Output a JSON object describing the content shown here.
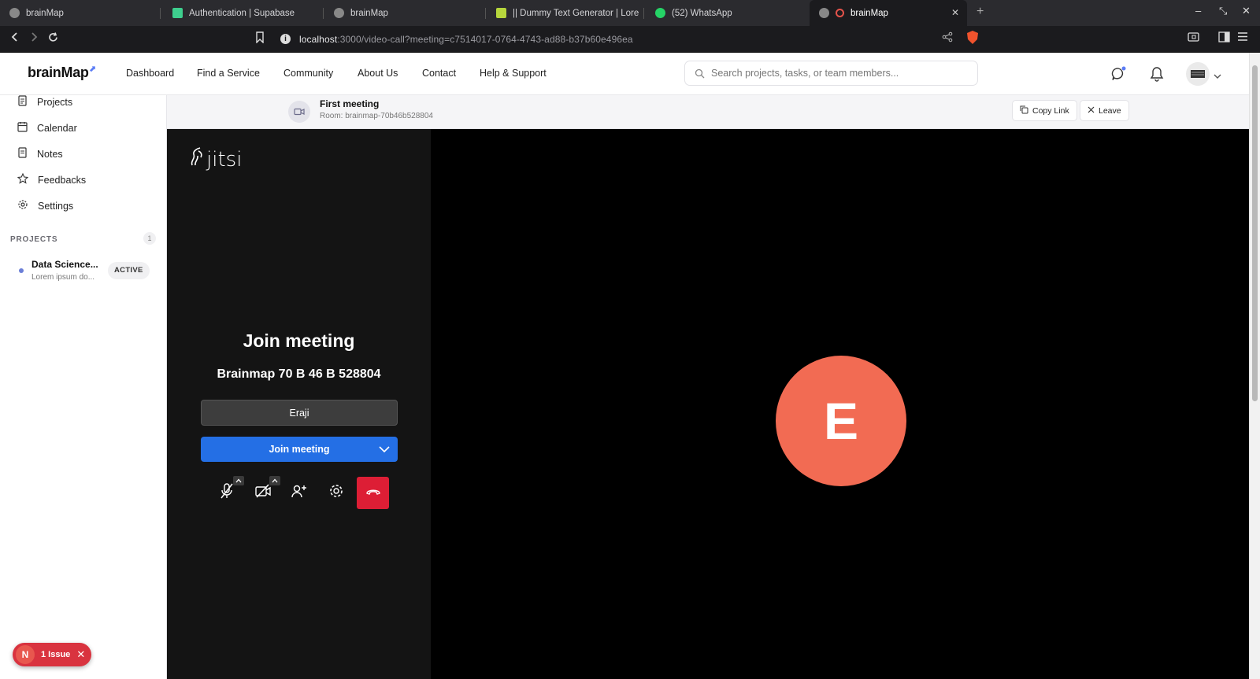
{
  "browser": {
    "tabs": [
      {
        "label": "brainMap",
        "favicon": "globe-icon"
      },
      {
        "label": "Authentication | Supabase",
        "favicon": "supabase-icon"
      },
      {
        "label": "brainMap",
        "favicon": "globe-icon"
      },
      {
        "label": "|| Dummy Text Generator | Lore",
        "favicon": "lorem-icon"
      },
      {
        "label": "(52) WhatsApp",
        "favicon": "whatsapp-icon"
      },
      {
        "label": "brainMap",
        "favicon": "globe-icon",
        "active": true
      }
    ],
    "url_host": "localhost",
    "url_rest": ":3000/video-call?meeting=c7514017-0764-4743-ad88-b37b60e496ea"
  },
  "header": {
    "logo": "brainMap",
    "nav": [
      "Dashboard",
      "Find a Service",
      "Community",
      "About Us",
      "Contact",
      "Help & Support"
    ],
    "search_placeholder": "Search projects, tasks, or team members..."
  },
  "sidebar": {
    "items": [
      {
        "label": "Projects",
        "icon": "document-icon"
      },
      {
        "label": "Calendar",
        "icon": "calendar-icon"
      },
      {
        "label": "Notes",
        "icon": "notes-icon"
      },
      {
        "label": "Feedbacks",
        "icon": "star-icon"
      },
      {
        "label": "Settings",
        "icon": "gear-icon"
      }
    ],
    "projects_title": "PROJECTS",
    "projects_count": "1",
    "project": {
      "name": "Data Science...",
      "desc": "Lorem ipsum do...",
      "status": "ACTIVE"
    },
    "issue": {
      "badge": "N",
      "label": "1 Issue"
    }
  },
  "meeting": {
    "title": "First meeting",
    "room": "Room: brainmap-70b46b528804",
    "copy_link": "Copy Link",
    "leave": "Leave"
  },
  "jitsi": {
    "logo": "jitsi",
    "join_title": "Join meeting",
    "room_name": "Brainmap 70 B 46 B 528804",
    "display_name": "Eraji",
    "join_button": "Join meeting",
    "avatar_initial": "E"
  },
  "colors": {
    "accent": "#246fe5",
    "hangup": "#dd1e35",
    "avatar": "#f26b53",
    "issue": "#d9333f"
  }
}
